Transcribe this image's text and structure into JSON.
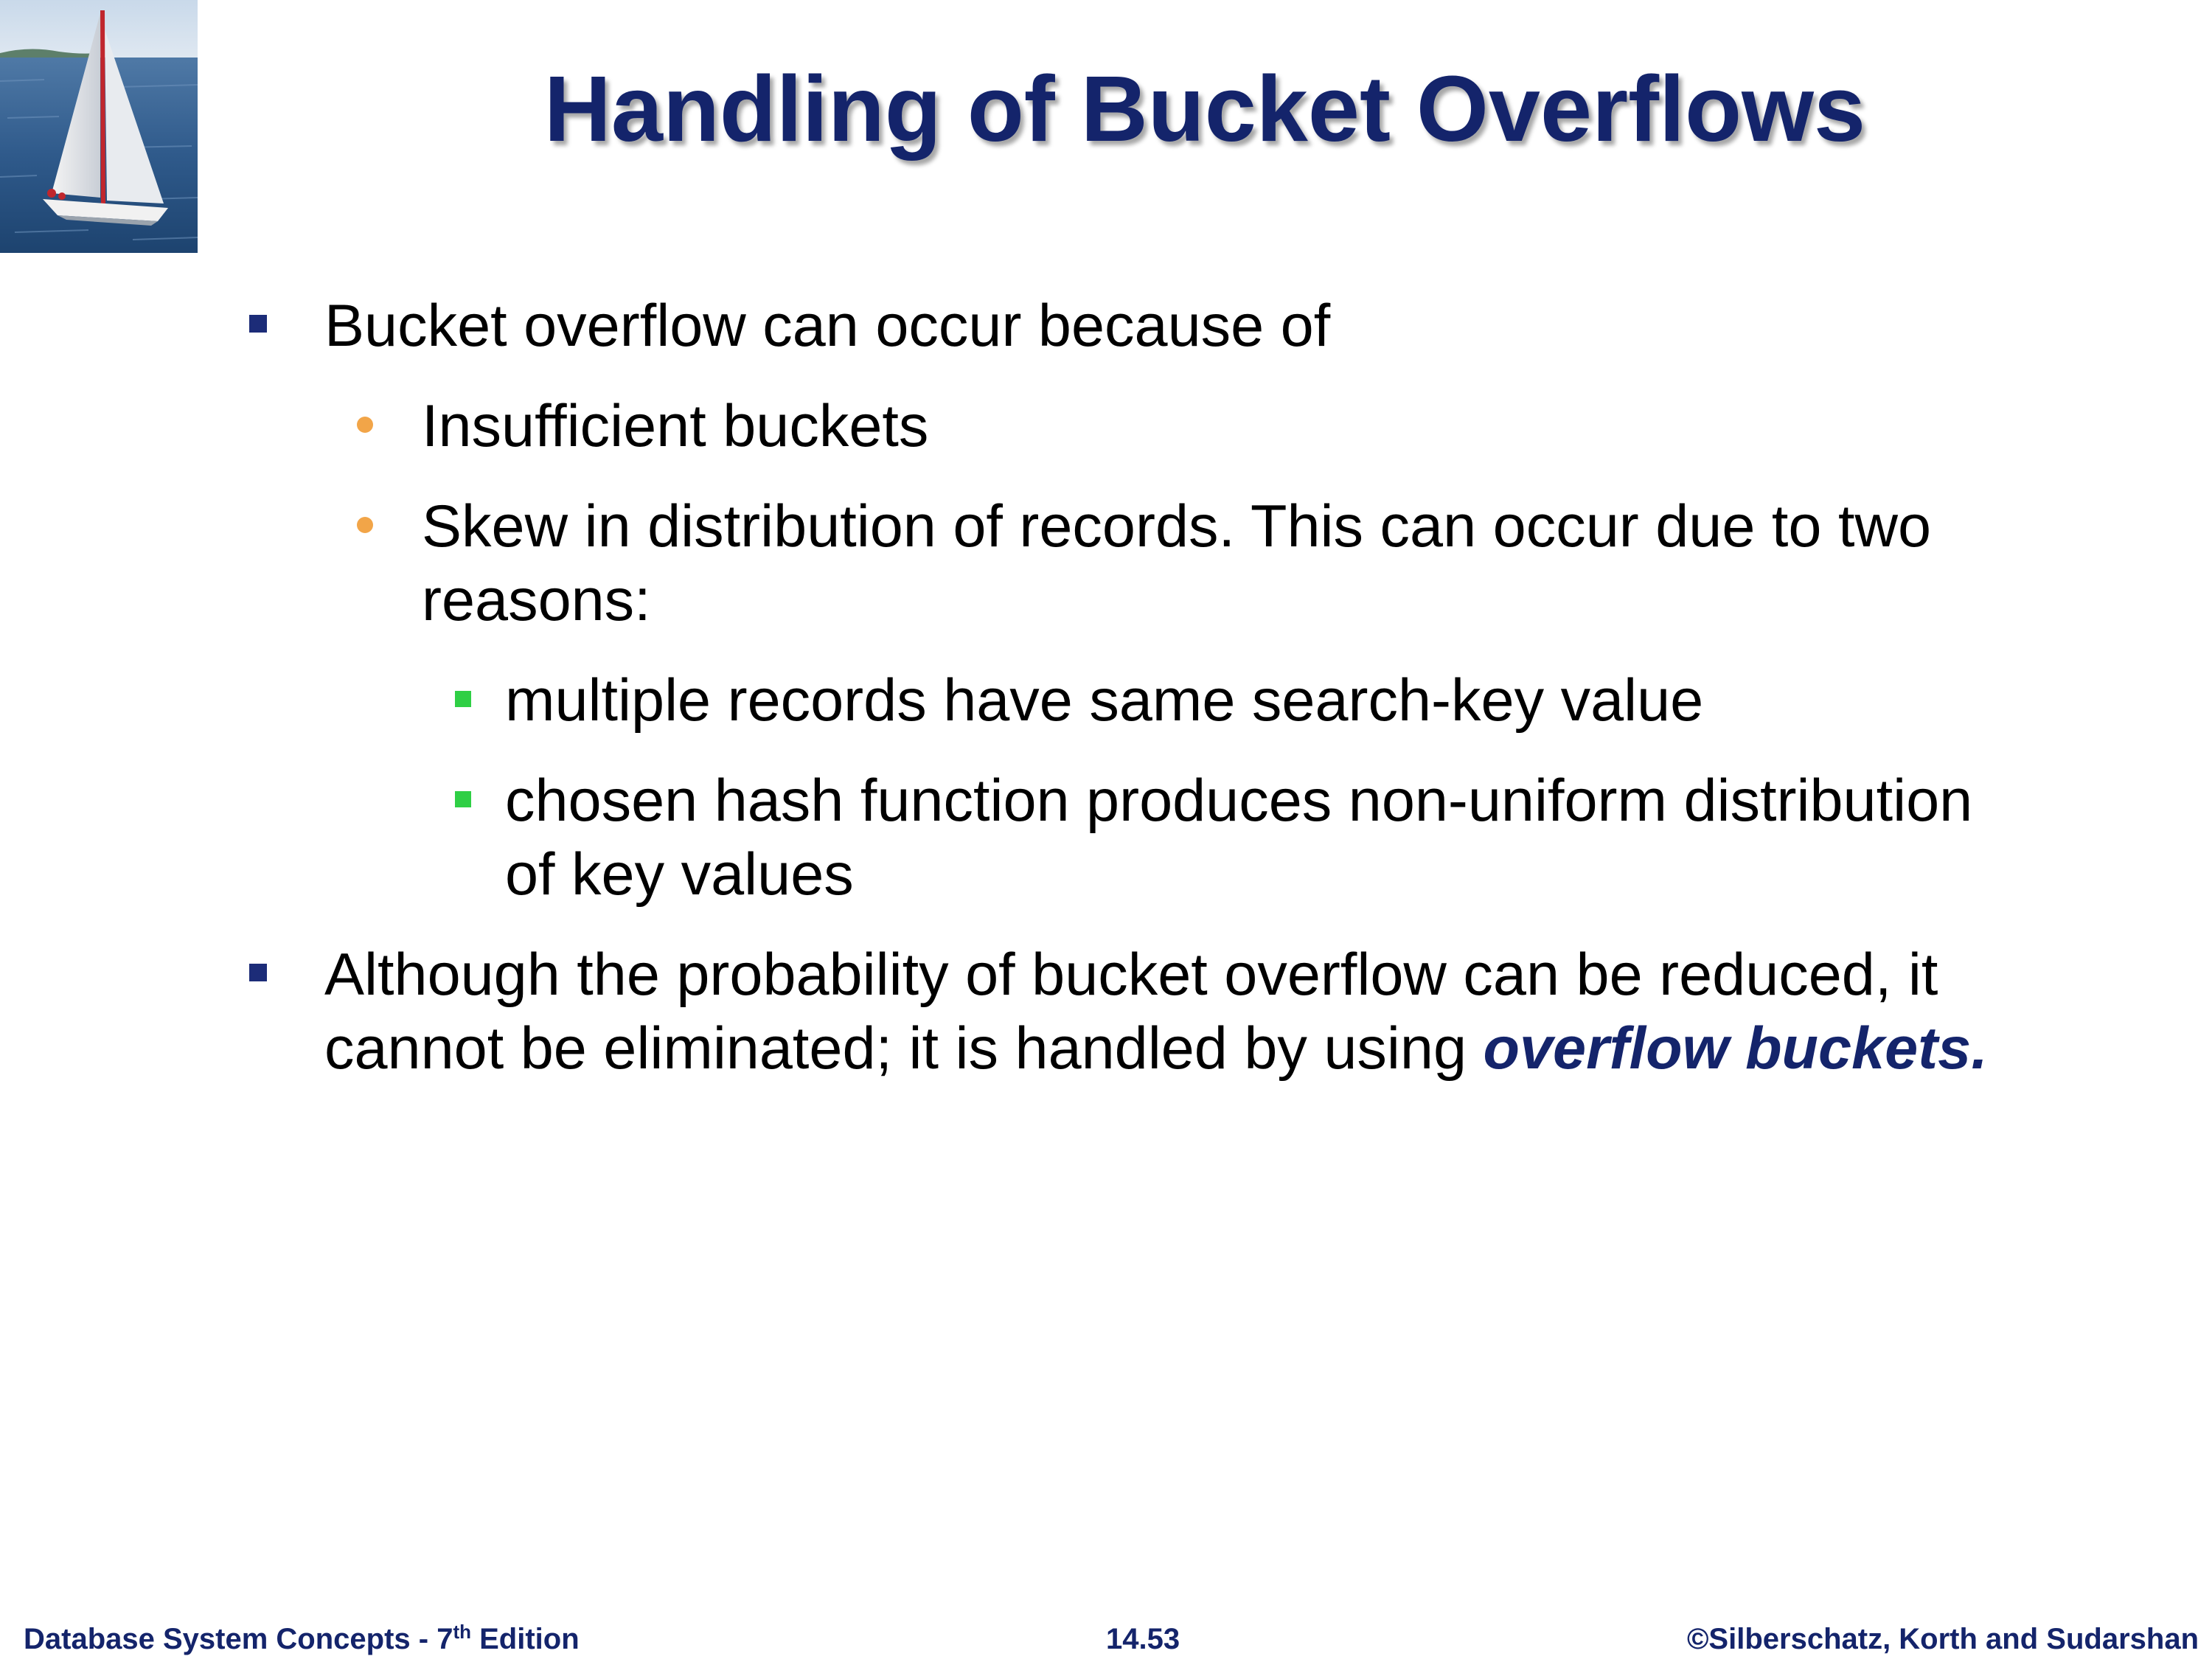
{
  "slide": {
    "title": "Handling of Bucket Overflows",
    "bullets": {
      "b1": "Bucket overflow can occur because of",
      "b1_1": "Insufficient buckets",
      "b1_2_line1": "Skew in distribution of records.  This can occur due to two",
      "b1_2_line2": "reasons:",
      "b1_2_1": "multiple records have same search-key value",
      "b1_2_2_line1": "chosen hash function produces non-uniform distribution",
      "b1_2_2_line2": "of key values",
      "b2_line1": "Although the probability of bucket overflow can be reduced, it",
      "b2_line2_prefix": "cannot be eliminated; it is handled by using ",
      "b2_line2_emphasis": "overflow buckets",
      "b2_line2_suffix": "."
    }
  },
  "footer": {
    "book_prefix": "Database System Concepts - 7",
    "book_sup": "th",
    "book_suffix": " Edition",
    "page_number": "14.53",
    "copyright": "©Silberschatz, Korth and Sudarshan"
  },
  "colors": {
    "title": "#14246b",
    "level1_bullet": "#1c2c78",
    "level2_bullet": "#f2a548",
    "level3_bullet": "#2fcf45",
    "emphasis": "#14246b"
  },
  "icons": {
    "logo": "sailboat-photo"
  }
}
